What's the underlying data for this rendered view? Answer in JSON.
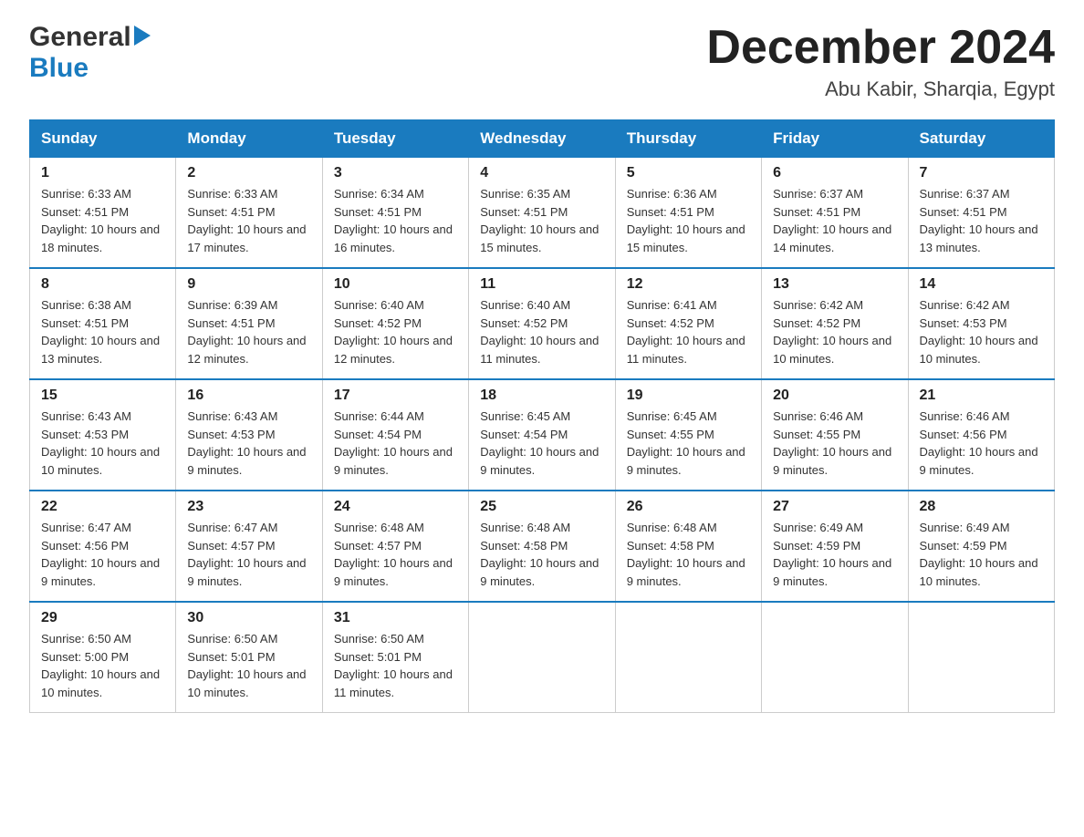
{
  "logo": {
    "general": "General",
    "blue": "Blue",
    "arrow": "▶"
  },
  "header": {
    "title": "December 2024",
    "subtitle": "Abu Kabir, Sharqia, Egypt"
  },
  "weekdays": [
    "Sunday",
    "Monday",
    "Tuesday",
    "Wednesday",
    "Thursday",
    "Friday",
    "Saturday"
  ],
  "weeks": [
    [
      {
        "day": "1",
        "sunrise": "6:33 AM",
        "sunset": "4:51 PM",
        "daylight": "10 hours and 18 minutes."
      },
      {
        "day": "2",
        "sunrise": "6:33 AM",
        "sunset": "4:51 PM",
        "daylight": "10 hours and 17 minutes."
      },
      {
        "day": "3",
        "sunrise": "6:34 AM",
        "sunset": "4:51 PM",
        "daylight": "10 hours and 16 minutes."
      },
      {
        "day": "4",
        "sunrise": "6:35 AM",
        "sunset": "4:51 PM",
        "daylight": "10 hours and 15 minutes."
      },
      {
        "day": "5",
        "sunrise": "6:36 AM",
        "sunset": "4:51 PM",
        "daylight": "10 hours and 15 minutes."
      },
      {
        "day": "6",
        "sunrise": "6:37 AM",
        "sunset": "4:51 PM",
        "daylight": "10 hours and 14 minutes."
      },
      {
        "day": "7",
        "sunrise": "6:37 AM",
        "sunset": "4:51 PM",
        "daylight": "10 hours and 13 minutes."
      }
    ],
    [
      {
        "day": "8",
        "sunrise": "6:38 AM",
        "sunset": "4:51 PM",
        "daylight": "10 hours and 13 minutes."
      },
      {
        "day": "9",
        "sunrise": "6:39 AM",
        "sunset": "4:51 PM",
        "daylight": "10 hours and 12 minutes."
      },
      {
        "day": "10",
        "sunrise": "6:40 AM",
        "sunset": "4:52 PM",
        "daylight": "10 hours and 12 minutes."
      },
      {
        "day": "11",
        "sunrise": "6:40 AM",
        "sunset": "4:52 PM",
        "daylight": "10 hours and 11 minutes."
      },
      {
        "day": "12",
        "sunrise": "6:41 AM",
        "sunset": "4:52 PM",
        "daylight": "10 hours and 11 minutes."
      },
      {
        "day": "13",
        "sunrise": "6:42 AM",
        "sunset": "4:52 PM",
        "daylight": "10 hours and 10 minutes."
      },
      {
        "day": "14",
        "sunrise": "6:42 AM",
        "sunset": "4:53 PM",
        "daylight": "10 hours and 10 minutes."
      }
    ],
    [
      {
        "day": "15",
        "sunrise": "6:43 AM",
        "sunset": "4:53 PM",
        "daylight": "10 hours and 10 minutes."
      },
      {
        "day": "16",
        "sunrise": "6:43 AM",
        "sunset": "4:53 PM",
        "daylight": "10 hours and 9 minutes."
      },
      {
        "day": "17",
        "sunrise": "6:44 AM",
        "sunset": "4:54 PM",
        "daylight": "10 hours and 9 minutes."
      },
      {
        "day": "18",
        "sunrise": "6:45 AM",
        "sunset": "4:54 PM",
        "daylight": "10 hours and 9 minutes."
      },
      {
        "day": "19",
        "sunrise": "6:45 AM",
        "sunset": "4:55 PM",
        "daylight": "10 hours and 9 minutes."
      },
      {
        "day": "20",
        "sunrise": "6:46 AM",
        "sunset": "4:55 PM",
        "daylight": "10 hours and 9 minutes."
      },
      {
        "day": "21",
        "sunrise": "6:46 AM",
        "sunset": "4:56 PM",
        "daylight": "10 hours and 9 minutes."
      }
    ],
    [
      {
        "day": "22",
        "sunrise": "6:47 AM",
        "sunset": "4:56 PM",
        "daylight": "10 hours and 9 minutes."
      },
      {
        "day": "23",
        "sunrise": "6:47 AM",
        "sunset": "4:57 PM",
        "daylight": "10 hours and 9 minutes."
      },
      {
        "day": "24",
        "sunrise": "6:48 AM",
        "sunset": "4:57 PM",
        "daylight": "10 hours and 9 minutes."
      },
      {
        "day": "25",
        "sunrise": "6:48 AM",
        "sunset": "4:58 PM",
        "daylight": "10 hours and 9 minutes."
      },
      {
        "day": "26",
        "sunrise": "6:48 AM",
        "sunset": "4:58 PM",
        "daylight": "10 hours and 9 minutes."
      },
      {
        "day": "27",
        "sunrise": "6:49 AM",
        "sunset": "4:59 PM",
        "daylight": "10 hours and 9 minutes."
      },
      {
        "day": "28",
        "sunrise": "6:49 AM",
        "sunset": "4:59 PM",
        "daylight": "10 hours and 10 minutes."
      }
    ],
    [
      {
        "day": "29",
        "sunrise": "6:50 AM",
        "sunset": "5:00 PM",
        "daylight": "10 hours and 10 minutes."
      },
      {
        "day": "30",
        "sunrise": "6:50 AM",
        "sunset": "5:01 PM",
        "daylight": "10 hours and 10 minutes."
      },
      {
        "day": "31",
        "sunrise": "6:50 AM",
        "sunset": "5:01 PM",
        "daylight": "10 hours and 11 minutes."
      },
      null,
      null,
      null,
      null
    ]
  ],
  "labels": {
    "sunrise": "Sunrise:",
    "sunset": "Sunset:",
    "daylight": "Daylight:"
  }
}
